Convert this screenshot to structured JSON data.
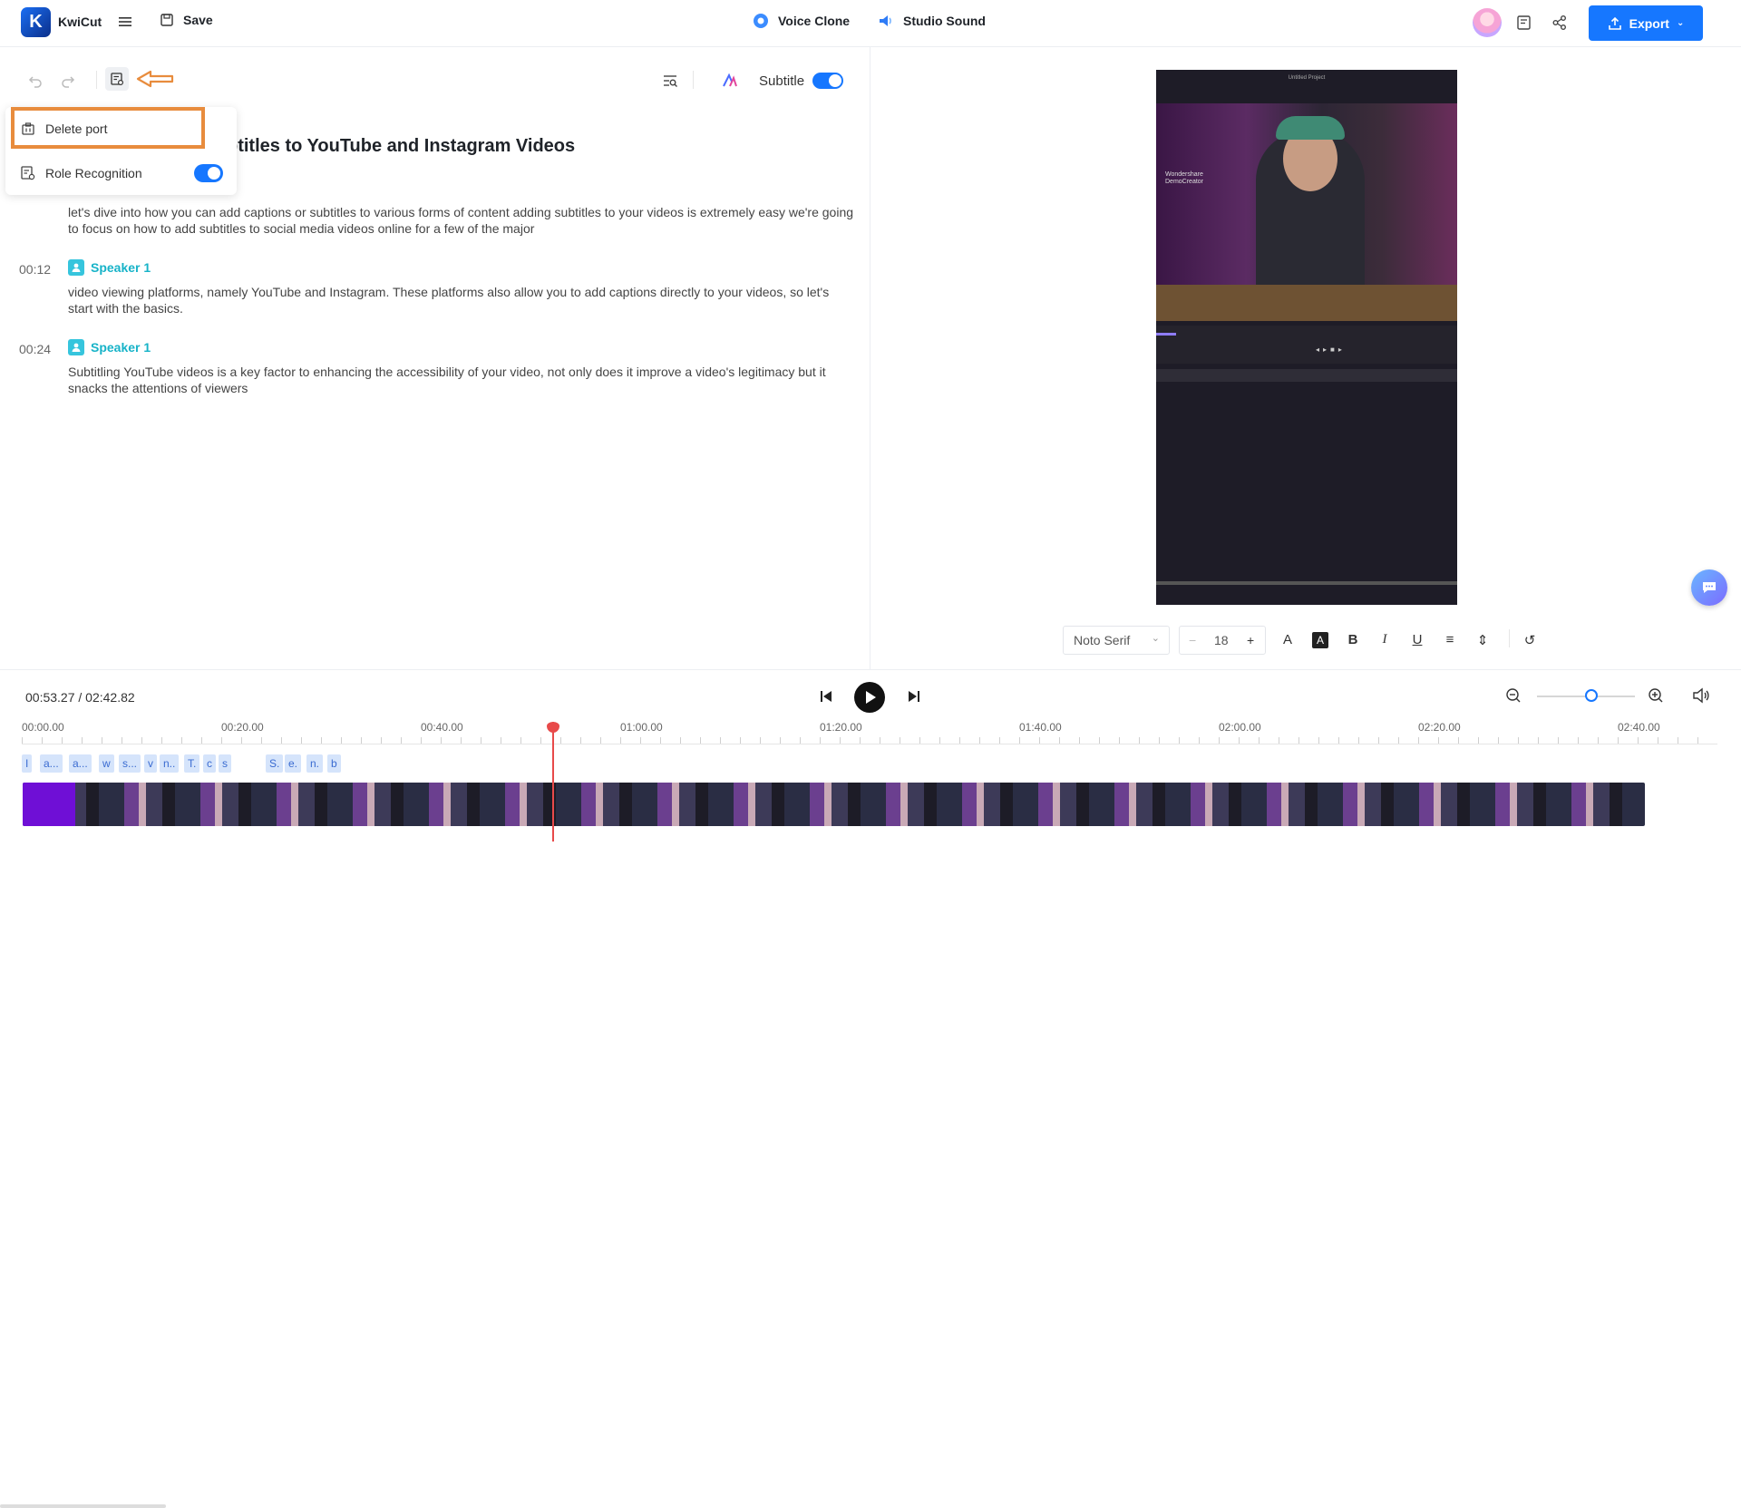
{
  "header": {
    "logo_letter": "K",
    "app_name": "KwiCut",
    "save_label": "Save",
    "voice_clone_label": "Voice Clone",
    "studio_sound_label": "Studio Sound",
    "export_label": "Export"
  },
  "editor": {
    "subtitle_label": "Subtitle",
    "subtitle_enabled": true,
    "title": "ptitles to YouTube and Instagram Videos",
    "paragraphs": [
      {
        "time": "",
        "speaker": "",
        "text": "let's dive into how you can add captions or subtitles to various forms of content adding subtitles to your videos is extremely easy we're going to focus on how to add subtitles to social media videos online for a few of the major"
      },
      {
        "time": "00:12",
        "speaker": "Speaker 1",
        "text": "video viewing platforms, namely YouTube and Instagram. These platforms also allow you to add captions directly to your videos, so let's start with the basics."
      },
      {
        "time": "00:24",
        "speaker": "Speaker 1",
        "text": "Subtitling YouTube videos is a key factor to enhancing the accessibility of your video, not only does it improve a video's legitimacy but it snacks the attentions of viewers"
      }
    ]
  },
  "popup_menu": {
    "items": [
      {
        "label": "Delete port"
      },
      {
        "label": "Role Recognition",
        "toggle": true
      }
    ]
  },
  "preview": {
    "top_text": "Untitled Project",
    "overlay_text": "Wondershare DemoCreator"
  },
  "format_bar": {
    "font": "Noto Serif",
    "size": "18"
  },
  "playback": {
    "current_time": "00:53.27",
    "separator": " / ",
    "total_time": "02:42.82"
  },
  "timeline": {
    "ruler_labels": [
      "00:00.00",
      "00:20.00",
      "00:40.00",
      "01:00.00",
      "01:20.00",
      "01:40.00",
      "02:00.00",
      "02:20.00",
      "02:40.00"
    ],
    "word_chips": [
      "I",
      "a...",
      "a...",
      "w",
      "s...",
      "v",
      "n..",
      "T.",
      "c",
      "s",
      "S.",
      "e.",
      "n.",
      "b"
    ]
  },
  "colors": {
    "accent": "#1677ff",
    "speaker": "#17b3c8",
    "highlight": "#e88c3d",
    "playhead": "#e84a4a"
  }
}
